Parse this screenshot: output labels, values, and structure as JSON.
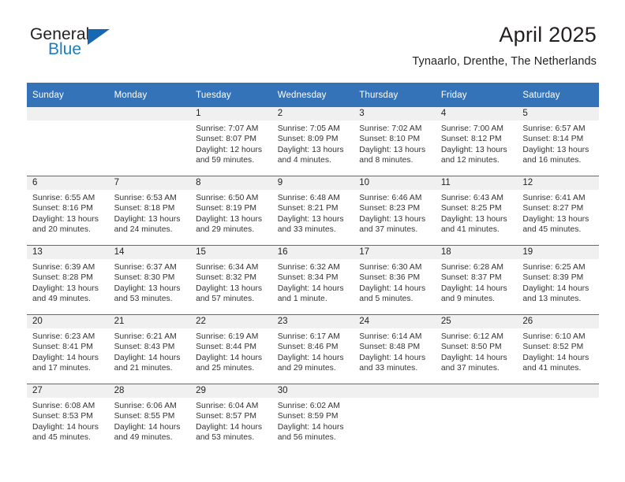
{
  "logo": {
    "word_one": "General",
    "word_two": "Blue",
    "triangle_color": "#1668b0",
    "blue_text_color": "#1a7fc1",
    "icon": "general-blue-logo"
  },
  "header": {
    "title": "April 2025",
    "subtitle": "Tynaarlo, Drenthe, The Netherlands"
  },
  "theme": {
    "header_blue": "#3573b9",
    "daynum_band_gray": "#f0f0f0",
    "text": "#231f20"
  },
  "calendar": {
    "weekday_headers": [
      "Sunday",
      "Monday",
      "Tuesday",
      "Wednesday",
      "Thursday",
      "Friday",
      "Saturday"
    ],
    "weeks": [
      [
        {
          "day": "",
          "lines": []
        },
        {
          "day": "",
          "lines": []
        },
        {
          "day": "1",
          "lines": [
            "Sunrise: 7:07 AM",
            "Sunset: 8:07 PM",
            "Daylight: 12 hours",
            "and 59 minutes."
          ]
        },
        {
          "day": "2",
          "lines": [
            "Sunrise: 7:05 AM",
            "Sunset: 8:09 PM",
            "Daylight: 13 hours",
            "and 4 minutes."
          ]
        },
        {
          "day": "3",
          "lines": [
            "Sunrise: 7:02 AM",
            "Sunset: 8:10 PM",
            "Daylight: 13 hours",
            "and 8 minutes."
          ]
        },
        {
          "day": "4",
          "lines": [
            "Sunrise: 7:00 AM",
            "Sunset: 8:12 PM",
            "Daylight: 13 hours",
            "and 12 minutes."
          ]
        },
        {
          "day": "5",
          "lines": [
            "Sunrise: 6:57 AM",
            "Sunset: 8:14 PM",
            "Daylight: 13 hours",
            "and 16 minutes."
          ]
        }
      ],
      [
        {
          "day": "6",
          "lines": [
            "Sunrise: 6:55 AM",
            "Sunset: 8:16 PM",
            "Daylight: 13 hours",
            "and 20 minutes."
          ]
        },
        {
          "day": "7",
          "lines": [
            "Sunrise: 6:53 AM",
            "Sunset: 8:18 PM",
            "Daylight: 13 hours",
            "and 24 minutes."
          ]
        },
        {
          "day": "8",
          "lines": [
            "Sunrise: 6:50 AM",
            "Sunset: 8:19 PM",
            "Daylight: 13 hours",
            "and 29 minutes."
          ]
        },
        {
          "day": "9",
          "lines": [
            "Sunrise: 6:48 AM",
            "Sunset: 8:21 PM",
            "Daylight: 13 hours",
            "and 33 minutes."
          ]
        },
        {
          "day": "10",
          "lines": [
            "Sunrise: 6:46 AM",
            "Sunset: 8:23 PM",
            "Daylight: 13 hours",
            "and 37 minutes."
          ]
        },
        {
          "day": "11",
          "lines": [
            "Sunrise: 6:43 AM",
            "Sunset: 8:25 PM",
            "Daylight: 13 hours",
            "and 41 minutes."
          ]
        },
        {
          "day": "12",
          "lines": [
            "Sunrise: 6:41 AM",
            "Sunset: 8:27 PM",
            "Daylight: 13 hours",
            "and 45 minutes."
          ]
        }
      ],
      [
        {
          "day": "13",
          "lines": [
            "Sunrise: 6:39 AM",
            "Sunset: 8:28 PM",
            "Daylight: 13 hours",
            "and 49 minutes."
          ]
        },
        {
          "day": "14",
          "lines": [
            "Sunrise: 6:37 AM",
            "Sunset: 8:30 PM",
            "Daylight: 13 hours",
            "and 53 minutes."
          ]
        },
        {
          "day": "15",
          "lines": [
            "Sunrise: 6:34 AM",
            "Sunset: 8:32 PM",
            "Daylight: 13 hours",
            "and 57 minutes."
          ]
        },
        {
          "day": "16",
          "lines": [
            "Sunrise: 6:32 AM",
            "Sunset: 8:34 PM",
            "Daylight: 14 hours",
            "and 1 minute."
          ]
        },
        {
          "day": "17",
          "lines": [
            "Sunrise: 6:30 AM",
            "Sunset: 8:36 PM",
            "Daylight: 14 hours",
            "and 5 minutes."
          ]
        },
        {
          "day": "18",
          "lines": [
            "Sunrise: 6:28 AM",
            "Sunset: 8:37 PM",
            "Daylight: 14 hours",
            "and 9 minutes."
          ]
        },
        {
          "day": "19",
          "lines": [
            "Sunrise: 6:25 AM",
            "Sunset: 8:39 PM",
            "Daylight: 14 hours",
            "and 13 minutes."
          ]
        }
      ],
      [
        {
          "day": "20",
          "lines": [
            "Sunrise: 6:23 AM",
            "Sunset: 8:41 PM",
            "Daylight: 14 hours",
            "and 17 minutes."
          ]
        },
        {
          "day": "21",
          "lines": [
            "Sunrise: 6:21 AM",
            "Sunset: 8:43 PM",
            "Daylight: 14 hours",
            "and 21 minutes."
          ]
        },
        {
          "day": "22",
          "lines": [
            "Sunrise: 6:19 AM",
            "Sunset: 8:44 PM",
            "Daylight: 14 hours",
            "and 25 minutes."
          ]
        },
        {
          "day": "23",
          "lines": [
            "Sunrise: 6:17 AM",
            "Sunset: 8:46 PM",
            "Daylight: 14 hours",
            "and 29 minutes."
          ]
        },
        {
          "day": "24",
          "lines": [
            "Sunrise: 6:14 AM",
            "Sunset: 8:48 PM",
            "Daylight: 14 hours",
            "and 33 minutes."
          ]
        },
        {
          "day": "25",
          "lines": [
            "Sunrise: 6:12 AM",
            "Sunset: 8:50 PM",
            "Daylight: 14 hours",
            "and 37 minutes."
          ]
        },
        {
          "day": "26",
          "lines": [
            "Sunrise: 6:10 AM",
            "Sunset: 8:52 PM",
            "Daylight: 14 hours",
            "and 41 minutes."
          ]
        }
      ],
      [
        {
          "day": "27",
          "lines": [
            "Sunrise: 6:08 AM",
            "Sunset: 8:53 PM",
            "Daylight: 14 hours",
            "and 45 minutes."
          ]
        },
        {
          "day": "28",
          "lines": [
            "Sunrise: 6:06 AM",
            "Sunset: 8:55 PM",
            "Daylight: 14 hours",
            "and 49 minutes."
          ]
        },
        {
          "day": "29",
          "lines": [
            "Sunrise: 6:04 AM",
            "Sunset: 8:57 PM",
            "Daylight: 14 hours",
            "and 53 minutes."
          ]
        },
        {
          "day": "30",
          "lines": [
            "Sunrise: 6:02 AM",
            "Sunset: 8:59 PM",
            "Daylight: 14 hours",
            "and 56 minutes."
          ]
        },
        {
          "day": "",
          "lines": []
        },
        {
          "day": "",
          "lines": []
        },
        {
          "day": "",
          "lines": []
        }
      ]
    ]
  }
}
